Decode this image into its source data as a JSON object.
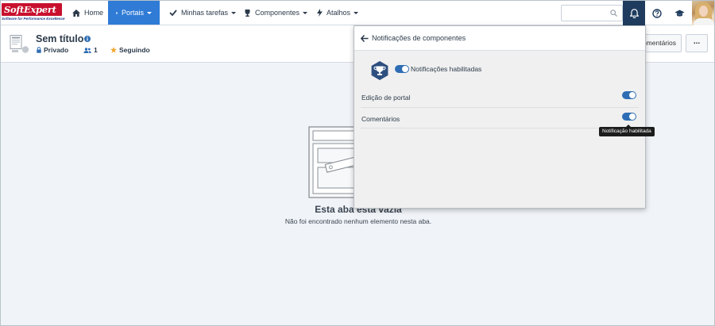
{
  "brand": {
    "logo_text": "SoftExpert",
    "tagline": "Software for Performance Excellence",
    "color": "#c8102e"
  },
  "topnav": {
    "items": [
      {
        "label": "Home",
        "icon": "home-icon"
      },
      {
        "label": "Portais",
        "icon": "grid-icon",
        "active": true
      },
      {
        "label": "Minhas tarefas",
        "icon": "check-icon"
      },
      {
        "label": "Componentes",
        "icon": "trophy-icon"
      },
      {
        "label": "Atalhos",
        "icon": "bolt-icon"
      }
    ],
    "search_placeholder": "",
    "accent": "#2f7bd6",
    "dark": "#1f3c5e"
  },
  "page": {
    "title": "Sem título",
    "privacy": "Privado",
    "members": "1",
    "follow": "Seguindo",
    "comments_button": "Comentários",
    "more_button": "..."
  },
  "empty_state": {
    "title": "Esta aba está vazia",
    "description": "Não foi encontrado nenhum elemento nesta aba."
  },
  "notifications": {
    "header": "Notificações de componentes",
    "enabled_label": "Notificações habilitadas",
    "rows": [
      {
        "label": "Edição de portal",
        "enabled": true
      },
      {
        "label": "Comentários",
        "enabled": true
      }
    ],
    "tooltip": "Notificação habilitada"
  }
}
